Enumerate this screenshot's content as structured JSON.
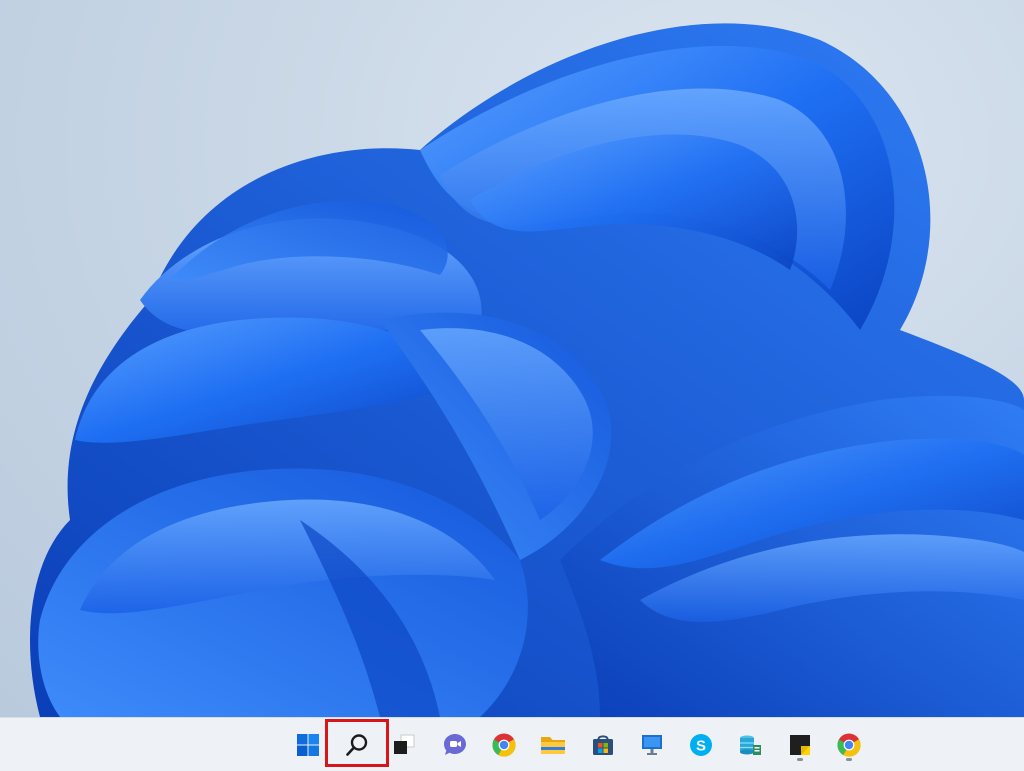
{
  "desktop": {
    "wallpaper_icon": "windows-bloom-wallpaper",
    "colors": {
      "background": "#c9d7e6",
      "bloom_dark": "#0a4fd6",
      "bloom_mid": "#1e6df2",
      "bloom_light": "#4d96ff"
    }
  },
  "taskbar": {
    "highlight_color": "#d7161b",
    "highlighted_item": "search",
    "items": [
      {
        "id": "start",
        "icon": "windows-logo-icon"
      },
      {
        "id": "search",
        "icon": "search-icon"
      },
      {
        "id": "task-view",
        "icon": "task-view-icon"
      },
      {
        "id": "chat",
        "icon": "teams-chat-icon"
      },
      {
        "id": "chrome",
        "icon": "chrome-icon"
      },
      {
        "id": "file-explorer",
        "icon": "folder-icon"
      },
      {
        "id": "store",
        "icon": "microsoft-store-icon"
      },
      {
        "id": "remote-desktop",
        "icon": "remote-desktop-icon"
      },
      {
        "id": "skype",
        "icon": "skype-icon"
      },
      {
        "id": "server-manager",
        "icon": "server-manager-icon"
      },
      {
        "id": "sticky-notes",
        "icon": "sticky-notes-icon"
      },
      {
        "id": "chrome-2",
        "icon": "chrome-icon"
      }
    ]
  }
}
